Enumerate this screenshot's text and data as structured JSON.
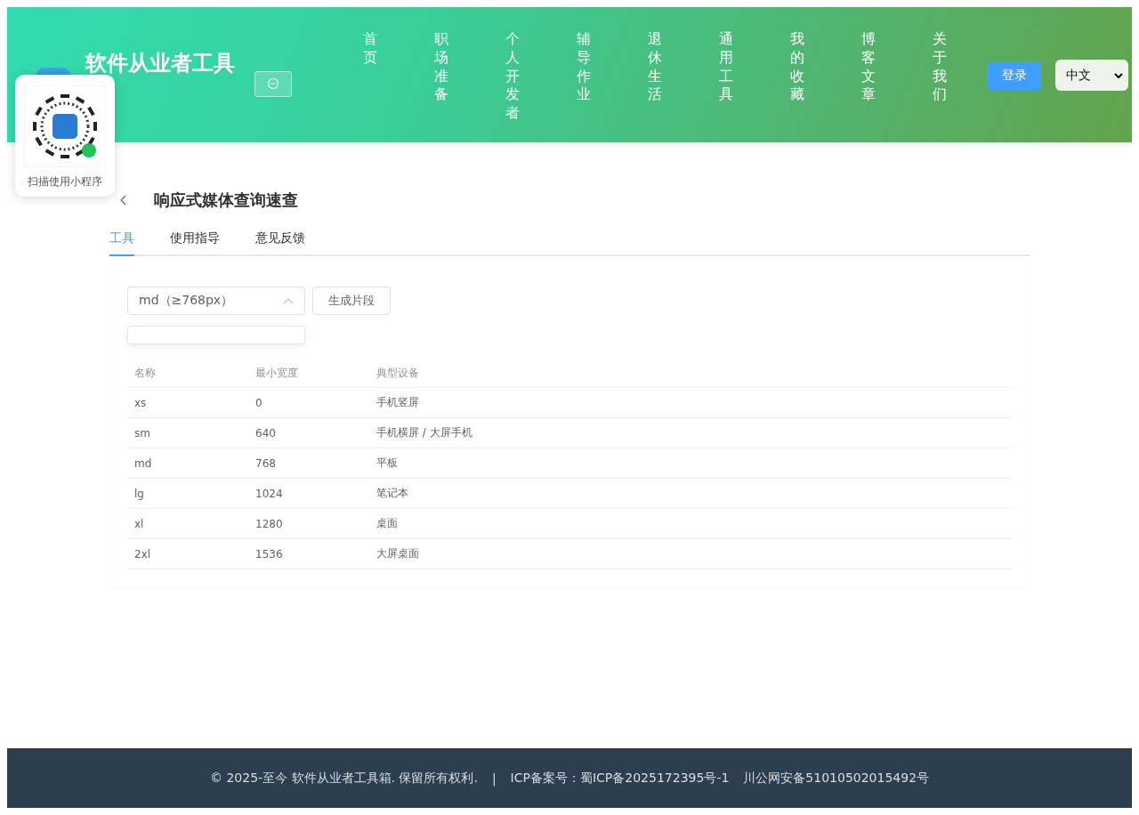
{
  "header": {
    "site_title": "软件从业者工具",
    "nav": [
      {
        "label": "首页"
      },
      {
        "label": "职场准备"
      },
      {
        "label": "个人开发者"
      },
      {
        "label": "辅导作业"
      },
      {
        "label": "退休生活"
      },
      {
        "label": "通用工具"
      },
      {
        "label": "我的收藏"
      },
      {
        "label": "博客文章"
      },
      {
        "label": "关于我们"
      }
    ],
    "login_button": "登录",
    "language": "中文"
  },
  "qr_popup": {
    "caption": "扫描使用小程序"
  },
  "page": {
    "title": "响应式媒体查询速查",
    "tabs": [
      {
        "label": "工具",
        "selected": true
      },
      {
        "label": "使用指导",
        "selected": false
      },
      {
        "label": "意见反馈",
        "selected": false
      }
    ],
    "breakpoint_select": {
      "value": "md（≥768px）",
      "expanded": true
    },
    "generate_button": "生成片段",
    "table": {
      "columns": [
        "名称",
        "最小宽度",
        "典型设备"
      ],
      "rows": [
        [
          "xs",
          "0",
          "手机竖屏"
        ],
        [
          "sm",
          "640",
          "手机横屏 / 大屏手机"
        ],
        [
          "md",
          "768",
          "平板"
        ],
        [
          "lg",
          "1024",
          "笔记本"
        ],
        [
          "xl",
          "1280",
          "桌面"
        ],
        [
          "2xl",
          "1536",
          "大屏桌面"
        ]
      ]
    }
  },
  "footer": {
    "copyright": "© 2025-至今 软件从业者工具箱. 保留所有权利.",
    "separator": "|",
    "icp": "ICP备案号：蜀ICP备2025172395号-1",
    "police": "川公网安备51010502015492号"
  }
}
